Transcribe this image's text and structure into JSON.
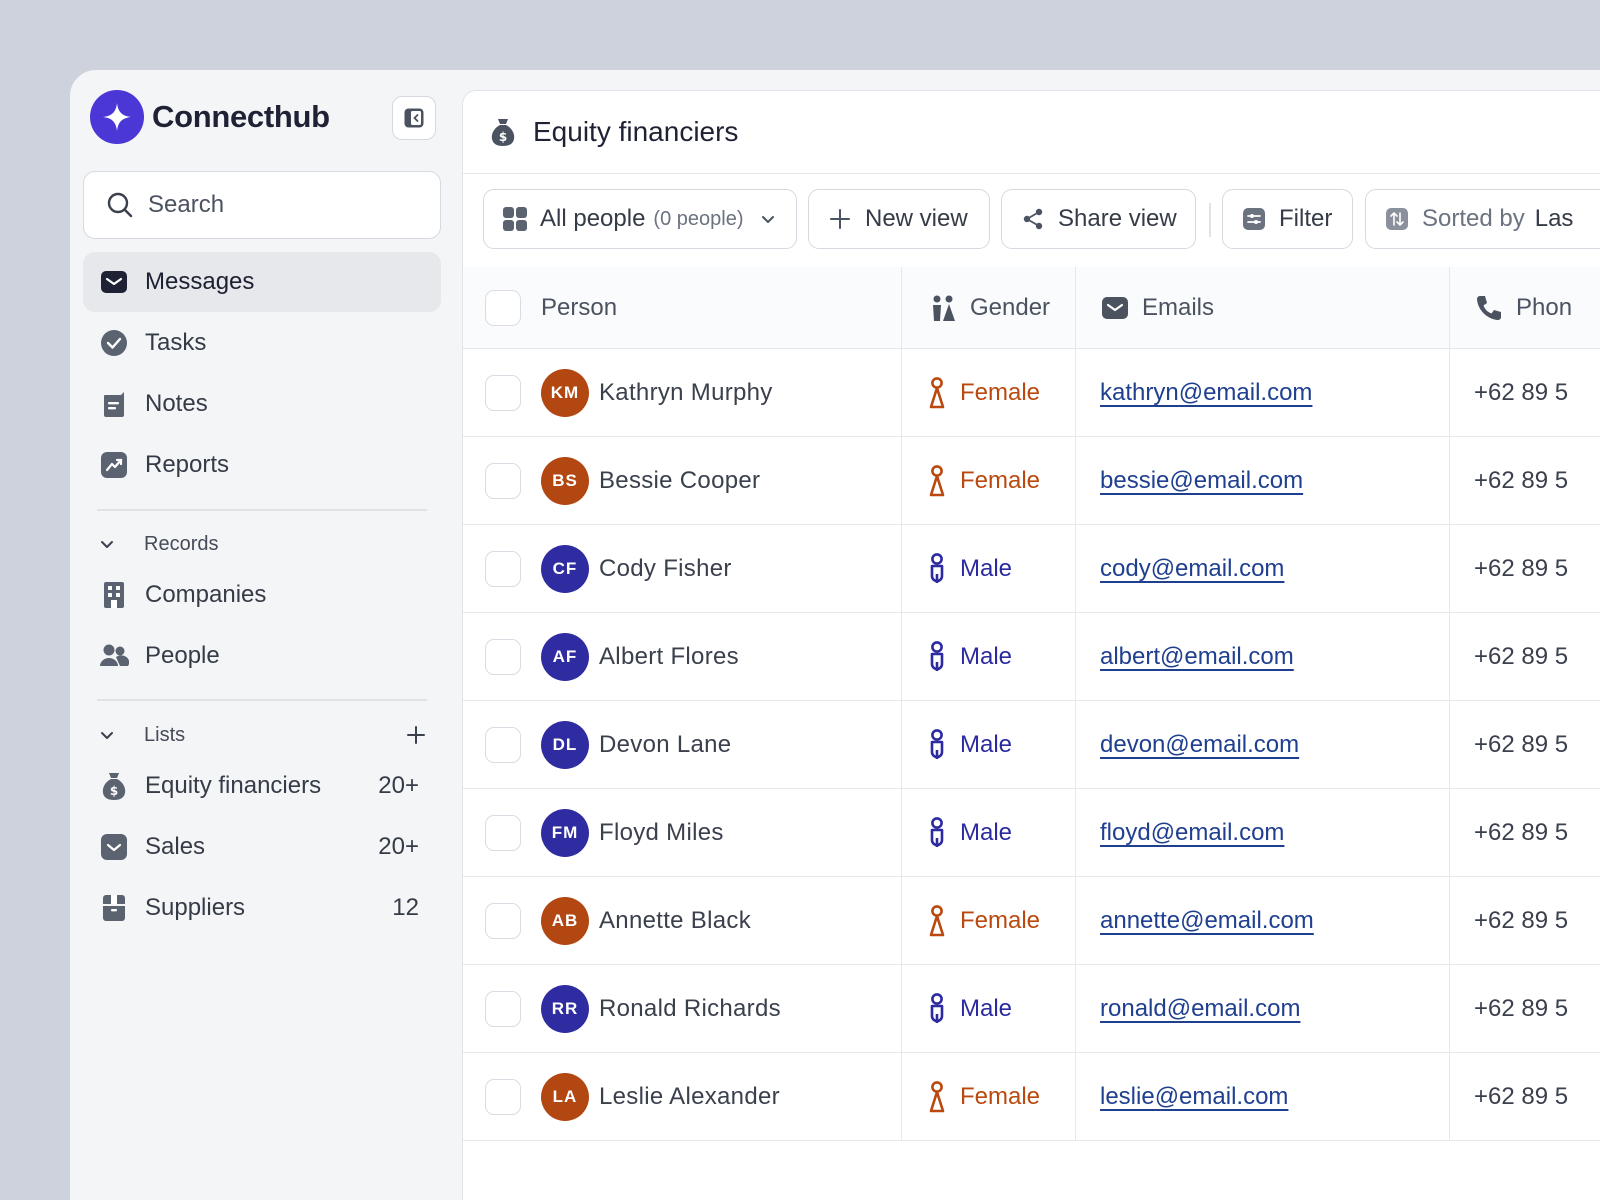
{
  "app": {
    "name": "Connecthub"
  },
  "search": {
    "placeholder": "Search"
  },
  "nav": [
    {
      "label": "Messages",
      "icon": "envelope-icon",
      "active": true
    },
    {
      "label": "Tasks",
      "icon": "check-circle-icon"
    },
    {
      "label": "Notes",
      "icon": "note-icon"
    },
    {
      "label": "Reports",
      "icon": "chart-icon"
    }
  ],
  "records": {
    "label": "Records",
    "items": [
      {
        "label": "Companies",
        "icon": "building-icon"
      },
      {
        "label": "People",
        "icon": "people-icon"
      }
    ]
  },
  "lists": {
    "label": "Lists",
    "items": [
      {
        "label": "Equity financiers",
        "count": "20+",
        "icon": "money-bag-icon"
      },
      {
        "label": "Sales",
        "count": "20+",
        "icon": "inbox-icon"
      },
      {
        "label": "Suppliers",
        "count": "12",
        "icon": "box-icon"
      }
    ]
  },
  "page": {
    "title": "Equity financiers"
  },
  "toolbar": {
    "view": {
      "label": "All people",
      "sub": "(0 people)"
    },
    "new_view": "New view",
    "share_view": "Share view",
    "filter": "Filter",
    "sorted_by": "Sorted by",
    "sorted_value": "Las"
  },
  "table": {
    "columns": {
      "person": "Person",
      "gender": "Gender",
      "emails": "Emails",
      "phone": "Phon"
    },
    "rows": [
      {
        "initials": "KM",
        "name": "Kathryn Murphy",
        "gender": "Female",
        "email": "kathryn@email.com",
        "phone": "+62 89 5"
      },
      {
        "initials": "BS",
        "name": "Bessie Cooper",
        "gender": "Female",
        "email": "bessie@email.com",
        "phone": "+62 89 5"
      },
      {
        "initials": "CF",
        "name": "Cody Fisher",
        "gender": "Male",
        "email": "cody@email.com",
        "phone": "+62 89 5"
      },
      {
        "initials": "AF",
        "name": "Albert Flores",
        "gender": "Male",
        "email": "albert@email.com",
        "phone": "+62 89 5"
      },
      {
        "initials": "DL",
        "name": "Devon Lane",
        "gender": "Male",
        "email": "devon@email.com",
        "phone": "+62 89 5"
      },
      {
        "initials": "FM",
        "name": "Floyd Miles",
        "gender": "Male",
        "email": "floyd@email.com",
        "phone": "+62 89 5"
      },
      {
        "initials": "AB",
        "name": "Annette Black",
        "gender": "Female",
        "email": "annette@email.com",
        "phone": "+62 89 5"
      },
      {
        "initials": "RR",
        "name": "Ronald Richards",
        "gender": "Male",
        "email": "ronald@email.com",
        "phone": "+62 89 5"
      },
      {
        "initials": "LA",
        "name": "Leslie Alexander",
        "gender": "Female",
        "email": "leslie@email.com",
        "phone": "+62 89 5"
      }
    ]
  },
  "colors": {
    "brand": "#4b36d6",
    "female": "#b9490f",
    "male": "#2b2aa0",
    "avatar_female": "#b24712",
    "avatar_male": "#2f2ba0",
    "link": "#1f3f8f"
  }
}
